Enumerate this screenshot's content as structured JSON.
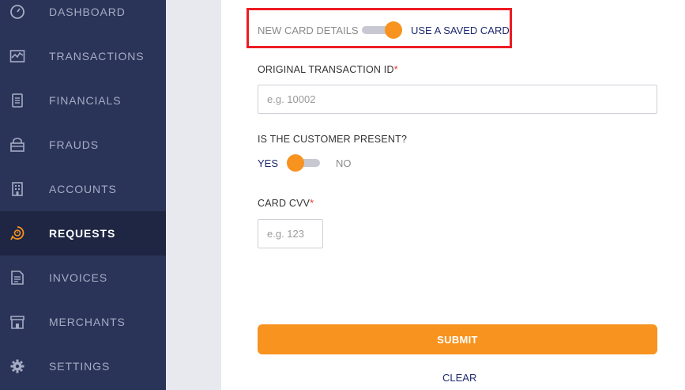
{
  "sidebar": {
    "items": [
      {
        "label": "DASHBOARD",
        "icon": "dashboard-icon",
        "active": false
      },
      {
        "label": "TRANSACTIONS",
        "icon": "transactions-icon",
        "active": false
      },
      {
        "label": "FINANCIALS",
        "icon": "financials-icon",
        "active": false
      },
      {
        "label": "FRAUDS",
        "icon": "frauds-icon",
        "active": false
      },
      {
        "label": "ACCOUNTS",
        "icon": "accounts-icon",
        "active": false
      },
      {
        "label": "REQUESTS",
        "icon": "requests-icon",
        "active": true
      },
      {
        "label": "INVOICES",
        "icon": "invoices-icon",
        "active": false
      },
      {
        "label": "MERCHANTS",
        "icon": "merchants-icon",
        "active": false
      },
      {
        "label": "SETTINGS",
        "icon": "settings-icon",
        "active": false
      }
    ]
  },
  "form": {
    "card_toggle": {
      "left_label": "NEW CARD DETAILS",
      "right_label": "USE A SAVED CARD",
      "selected": "USE A SAVED CARD"
    },
    "transaction_id": {
      "label": "ORIGINAL TRANSACTION ID",
      "required_mark": "*",
      "placeholder": "e.g. 10002",
      "value": ""
    },
    "customer_present": {
      "label": "IS THE CUSTOMER PRESENT?",
      "yes_label": "YES",
      "no_label": "NO",
      "selected": "YES"
    },
    "card_cvv": {
      "label": "CARD CVV",
      "required_mark": "*",
      "placeholder": "e.g. 123",
      "value": ""
    },
    "submit_label": "SUBMIT",
    "clear_label": "CLEAR"
  },
  "colors": {
    "sidebar_bg": "#2a3458",
    "sidebar_active_bg": "#1e2643",
    "accent": "#f7931e",
    "link": "#1f2a6e",
    "highlight_border": "#ec1c24"
  }
}
